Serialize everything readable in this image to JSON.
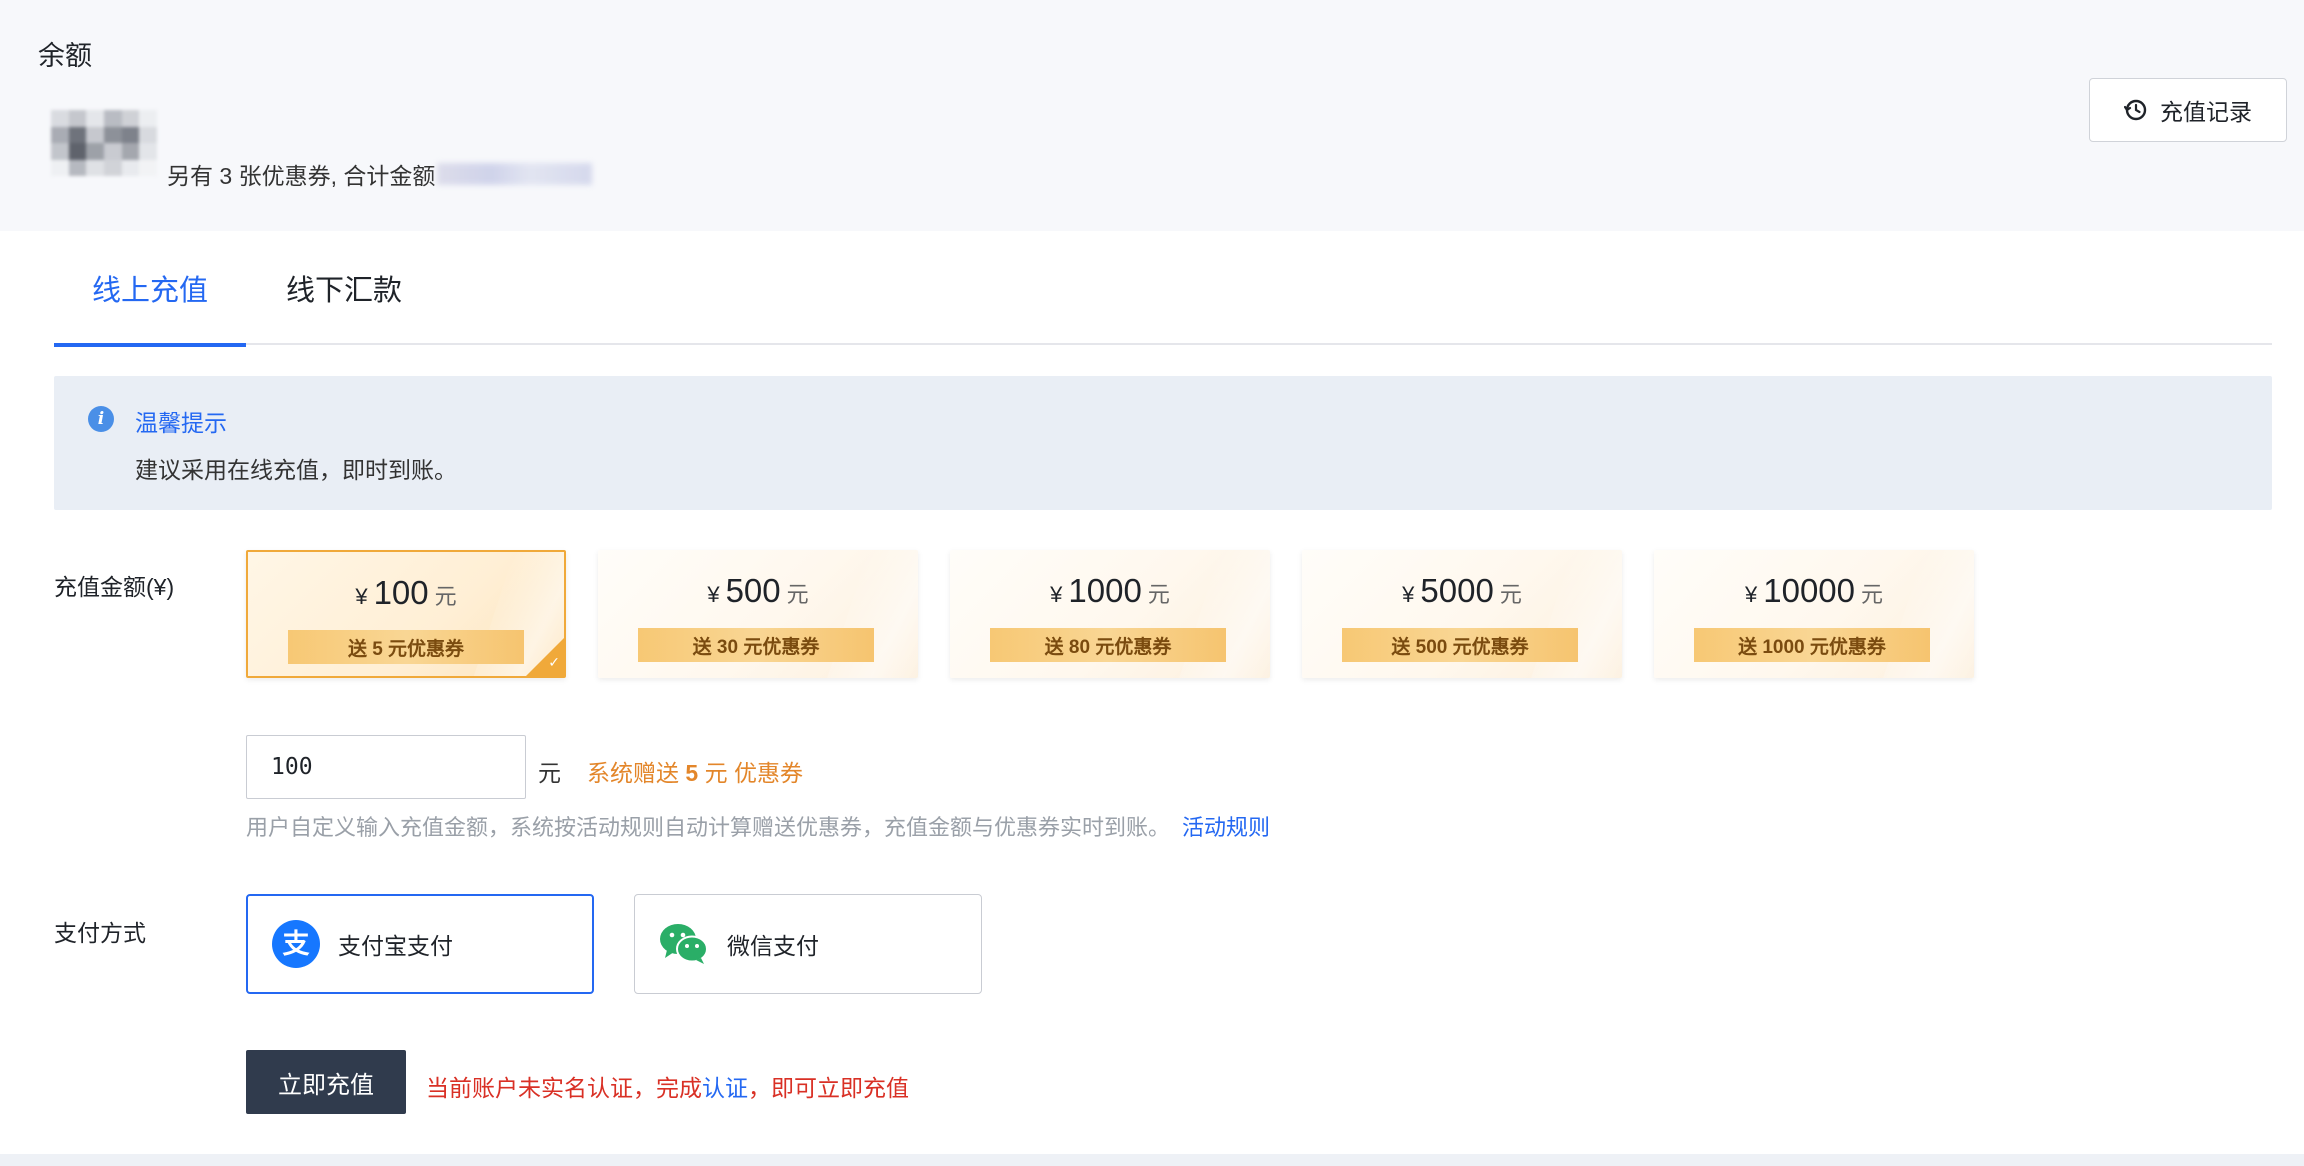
{
  "balance": {
    "title": "余额",
    "coupon_summary": "另有 3 张优惠券, 合计金额"
  },
  "header": {
    "record_button_label": "充值记录"
  },
  "tabs": [
    {
      "label": "线上充值",
      "active": true
    },
    {
      "label": "线下汇款",
      "active": false
    }
  ],
  "tip": {
    "title": "温馨提示",
    "text": "建议采用在线充值，即时到账。"
  },
  "amount": {
    "label": "充值金额(¥)",
    "currency_symbol": "¥",
    "unit": "元",
    "options": [
      {
        "value": "100",
        "coupon": "送 5 元优惠券",
        "selected": true
      },
      {
        "value": "500",
        "coupon": "送 30 元优惠券",
        "selected": false
      },
      {
        "value": "1000",
        "coupon": "送 80 元优惠券",
        "selected": false
      },
      {
        "value": "5000",
        "coupon": "送 500 元优惠券",
        "selected": false
      },
      {
        "value": "10000",
        "coupon": "送 1000 元优惠券",
        "selected": false
      }
    ],
    "custom_value": "100",
    "custom_unit": "元",
    "gift_prefix": "系统赠送",
    "gift_amount": "5",
    "gift_suffix": "元 优惠券",
    "hint": "用户自定义输入充值金额，系统按活动规则自动计算赠送优惠券，充值金额与优惠券实时到账。",
    "rules_link": "活动规则"
  },
  "payment": {
    "label": "支付方式",
    "options": [
      {
        "label": "支付宝支付",
        "icon": "alipay-icon",
        "selected": true
      },
      {
        "label": "微信支付",
        "icon": "wechat-icon",
        "selected": false
      }
    ]
  },
  "submit": {
    "label": "立即充值",
    "warning_prefix": "当前账户未实名认证，完成",
    "warning_link": "认证",
    "warning_suffix": "，即可立即充值"
  },
  "colors": {
    "primary": "#2468f2",
    "warning": "#d93025",
    "gift": "#e3862a",
    "selected_card_border": "#f0a93a",
    "submit_bg": "#303b4d"
  }
}
